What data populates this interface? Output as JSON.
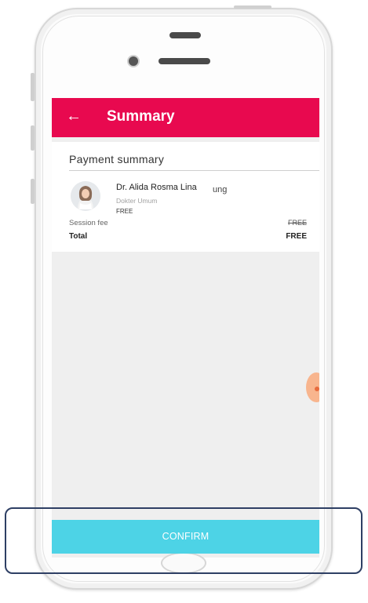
{
  "appbar": {
    "back_glyph": "←",
    "title": "Summary"
  },
  "card": {
    "section_title": "Payment summary",
    "doctor": {
      "name": "Dr. Alida Rosma Lina",
      "name_tail": "ung",
      "role": "Dokter Umum",
      "price": "FREE"
    },
    "session_fee_label": "Session fee",
    "session_fee_value": "FREE",
    "total_label": "Total",
    "total_value": "FREE"
  },
  "actions": {
    "confirm_label": "CONFIRM"
  },
  "colors": {
    "appbar": "#e8094f",
    "confirm": "#4dd3e6",
    "highlight_border": "#2e3f64"
  },
  "icons": {
    "back": "arrow-left-icon",
    "avatar": "doctor-avatar",
    "fab": "floating-chat-icon"
  }
}
